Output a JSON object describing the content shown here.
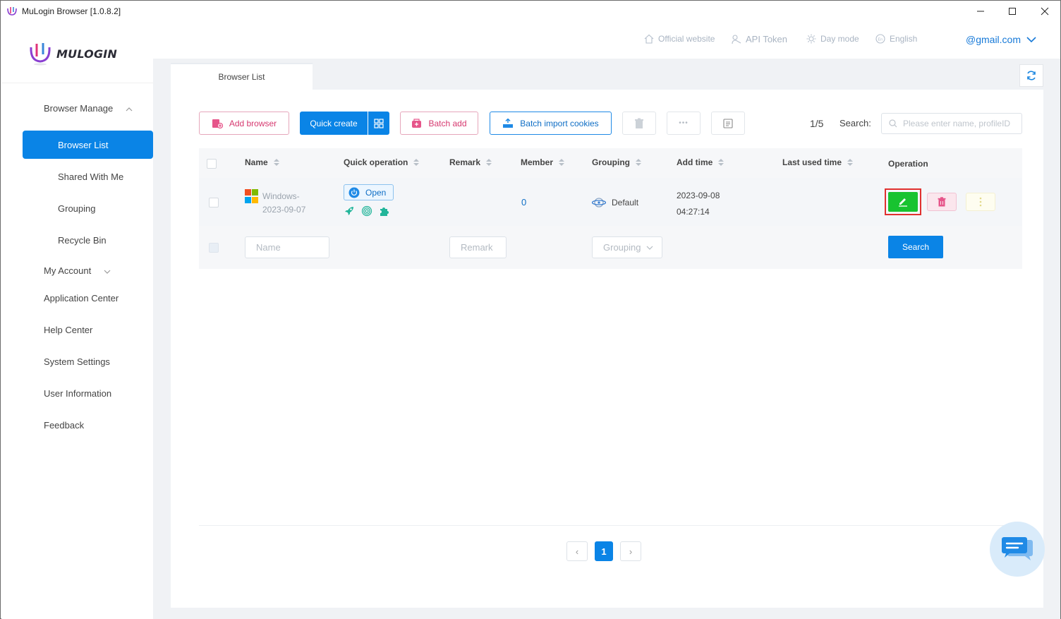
{
  "window": {
    "title": "MuLogin Browser  [1.0.8.2]",
    "controls": {
      "minimize": "—",
      "maximize": "☐",
      "close": "✕"
    }
  },
  "logo": {
    "text": "MULOGIN"
  },
  "sidebar": {
    "browser_manage": "Browser Manage",
    "browser_list": "Browser List",
    "shared_with_me": "Shared With Me",
    "grouping": "Grouping",
    "recycle_bin": "Recycle Bin",
    "my_account": "My Account",
    "application_center": "Application Center",
    "help_center": "Help Center",
    "system_settings": "System Settings",
    "user_information": "User Information",
    "feedback": "Feedback"
  },
  "header": {
    "official_website": "Official website",
    "api_token": "API Token",
    "day_mode": "Day mode",
    "language": "English",
    "account": "@gmail.com"
  },
  "tabs": {
    "active": "Browser List"
  },
  "toolbar": {
    "add_browser": "Add browser",
    "quick_create": "Quick create",
    "batch_add": "Batch add",
    "batch_import_cookies": "Batch import cookies",
    "more": "•••",
    "page_count": "1/5",
    "search_label": "Search:",
    "search_placeholder": "Please enter name, profileID"
  },
  "table": {
    "columns": {
      "name": "Name",
      "quick_operation": "Quick operation",
      "remark": "Remark",
      "member": "Member",
      "grouping": "Grouping",
      "add_time": "Add time",
      "last_used_time": "Last used time",
      "operation": "Operation"
    },
    "rows": [
      {
        "name_line1": "Windows-",
        "name_line2": "2023-09-07",
        "open_label": "Open",
        "member": "0",
        "grouping": "Default",
        "add_date": "2023-09-08",
        "add_clock": "04:27:14",
        "last_used": ""
      }
    ],
    "filter": {
      "name_placeholder": "Name",
      "remark_placeholder": "Remark",
      "grouping_placeholder": "Grouping",
      "search_button": "Search"
    }
  },
  "pagination": {
    "prev": "‹",
    "current": "1",
    "next": "›"
  },
  "colors": {
    "accent": "#0a84e6",
    "pink": "#d6386f",
    "edit_green": "#18c330",
    "highlight_red": "#e0312f"
  }
}
